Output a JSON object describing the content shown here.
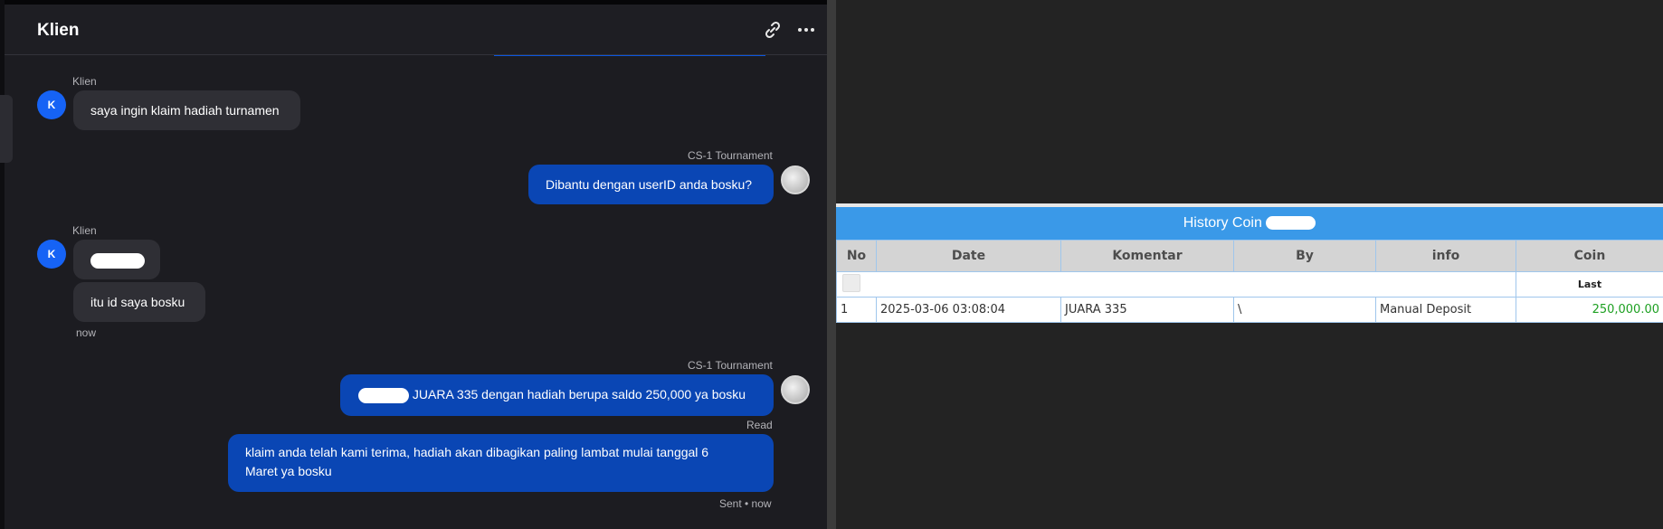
{
  "chat": {
    "title": "Klien",
    "messages": [
      {
        "sender": "Klien",
        "avatar": "K",
        "text": "saya ingin klaim hadiah turnamen"
      },
      {
        "sender": "CS-1 Tournament",
        "text": "Dibantu dengan userID anda bosku?"
      },
      {
        "sender": "Klien",
        "avatar": "K",
        "text": "itu id saya bosku",
        "time": "now"
      },
      {
        "sender": "CS-1 Tournament",
        "text": "JUARA 335 dengan hadiah berupa saldo 250,000 ya bosku",
        "status": "Read"
      },
      {
        "text": "klaim anda telah kami terima, hadiah akan dibagikan paling lambat mulai tanggal 6 Maret ya bosku",
        "status": "Sent • now"
      }
    ]
  },
  "coin_history": {
    "title": "History Coin",
    "columns": [
      "No",
      "Date",
      "Komentar",
      "By",
      "info",
      "Coin"
    ],
    "sub_header": "Last",
    "rows": [
      {
        "no": "1",
        "date": "2025-03-06 03:08:04",
        "komentar": "JUARA 335",
        "by": "\\",
        "info": "Manual Deposit",
        "coin": "250,000.00"
      }
    ]
  },
  "colors": {
    "accent_blue": "#0a46b4",
    "avatar_blue": "#1663f5",
    "table_header_blue": "#3a99e8",
    "amount_green": "#1ea022"
  },
  "icons": [
    "link-icon",
    "more-options-icon"
  ]
}
